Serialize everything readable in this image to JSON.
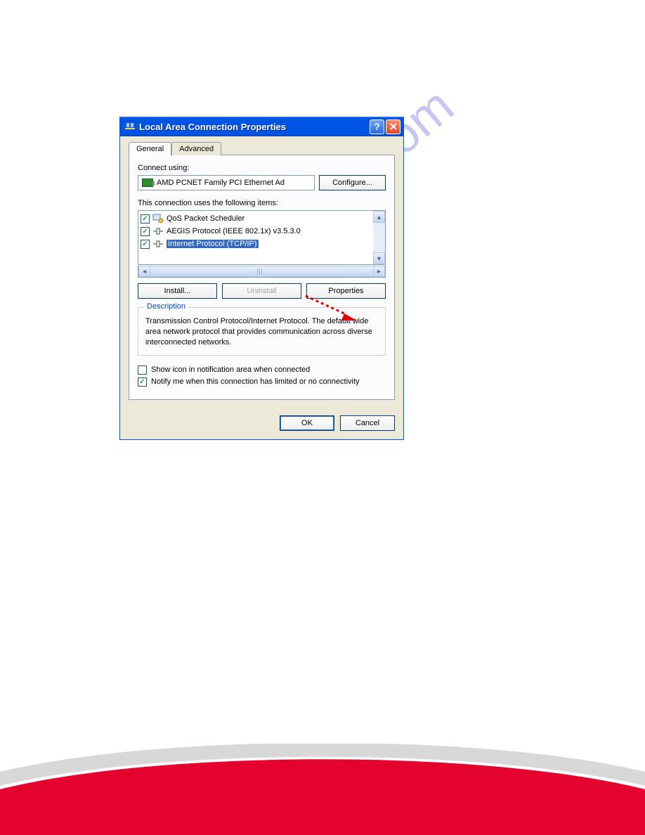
{
  "watermark": "manualshive.com",
  "dialog": {
    "title": "Local Area Connection Properties",
    "tabs": {
      "general": "General",
      "advanced": "Advanced"
    },
    "connect_using_label": "Connect using:",
    "adapter": "AMD PCNET Family PCI Ethernet Ad",
    "configure_btn": "Configure...",
    "items_label": "This connection uses the following items:",
    "items": [
      {
        "label": "QoS Packet Scheduler",
        "checked": true,
        "selected": false
      },
      {
        "label": "AEGIS Protocol (IEEE 802.1x) v3.5.3.0",
        "checked": true,
        "selected": false
      },
      {
        "label": "Internet Protocol (TCP/IP)",
        "checked": true,
        "selected": true
      }
    ],
    "install_btn": "Install...",
    "uninstall_btn": "Uninstall",
    "properties_btn": "Properties",
    "description_title": "Description",
    "description_text": "Transmission Control Protocol/Internet Protocol. The default wide area network protocol that provides communication across diverse interconnected networks.",
    "show_icon_label": "Show icon in notification area when connected",
    "notify_label": "Notify me when this connection has limited or no connectivity",
    "ok_btn": "OK",
    "cancel_btn": "Cancel"
  }
}
